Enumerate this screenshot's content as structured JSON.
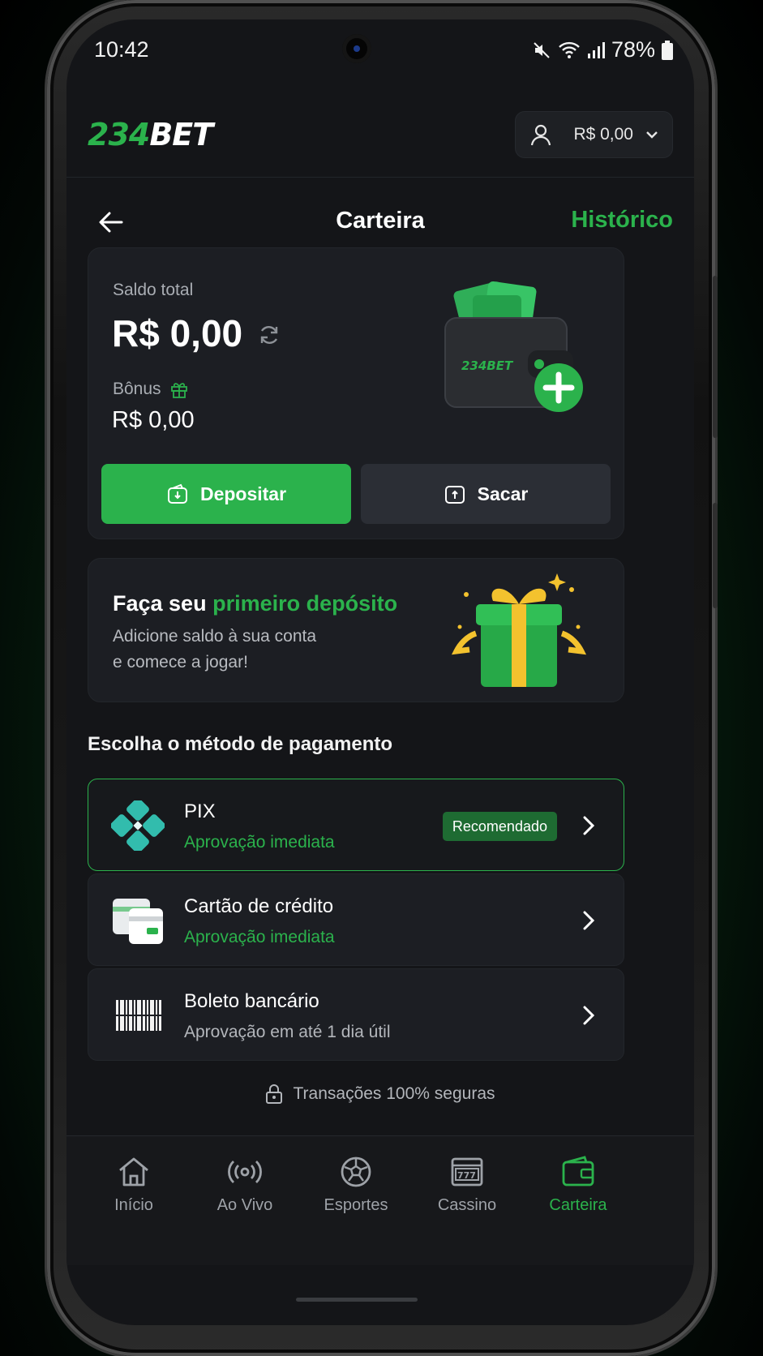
{
  "status_bar": {
    "time": "10:42",
    "battery": "78%"
  },
  "header": {
    "logo_number": "234",
    "logo_word": "BET",
    "balance": "R$ 0,00"
  },
  "page": {
    "title": "Carteira",
    "history_link": "Histórico"
  },
  "balance_card": {
    "total_label": "Saldo total",
    "total_value": "R$ 0,00",
    "bonus_label": "Bônus",
    "bonus_value": "R$ 0,00",
    "wallet_brand": "234BET",
    "deposit_label": "Depositar",
    "withdraw_label": "Sacar"
  },
  "promo": {
    "title_prefix": "Faça seu ",
    "title_highlight": "primeiro depósito",
    "subtitle_line1": "Adicione saldo à sua conta",
    "subtitle_line2": "e comece a jogar!"
  },
  "payment_section_title": "Escolha o método de pagamento",
  "payment_methods": [
    {
      "name": "PIX",
      "note": "Aprovação imediata",
      "badge": "Recomendado",
      "icon": "pix-icon",
      "selected": true
    },
    {
      "name": "Cartão de crédito",
      "note": "Aprovação imediata",
      "icon": "credit-card-icon",
      "selected": false
    },
    {
      "name": "Boleto bancário",
      "note": "Aprovação em até 1 dia útil",
      "icon": "barcode-icon",
      "selected": false
    }
  ],
  "secure_note": "Transações 100% seguras",
  "bottom_nav": [
    {
      "label": "Início",
      "icon": "home-icon"
    },
    {
      "label": "Ao Vivo",
      "icon": "live-icon"
    },
    {
      "label": "Esportes",
      "icon": "soccer-ball-icon"
    },
    {
      "label": "Cassino",
      "icon": "slot-machine-icon"
    },
    {
      "label": "Carteira",
      "icon": "wallet-icon",
      "active": true
    }
  ],
  "colors": {
    "accent": "#2bb24c",
    "background": "#141518",
    "card": "#1c1e23"
  }
}
